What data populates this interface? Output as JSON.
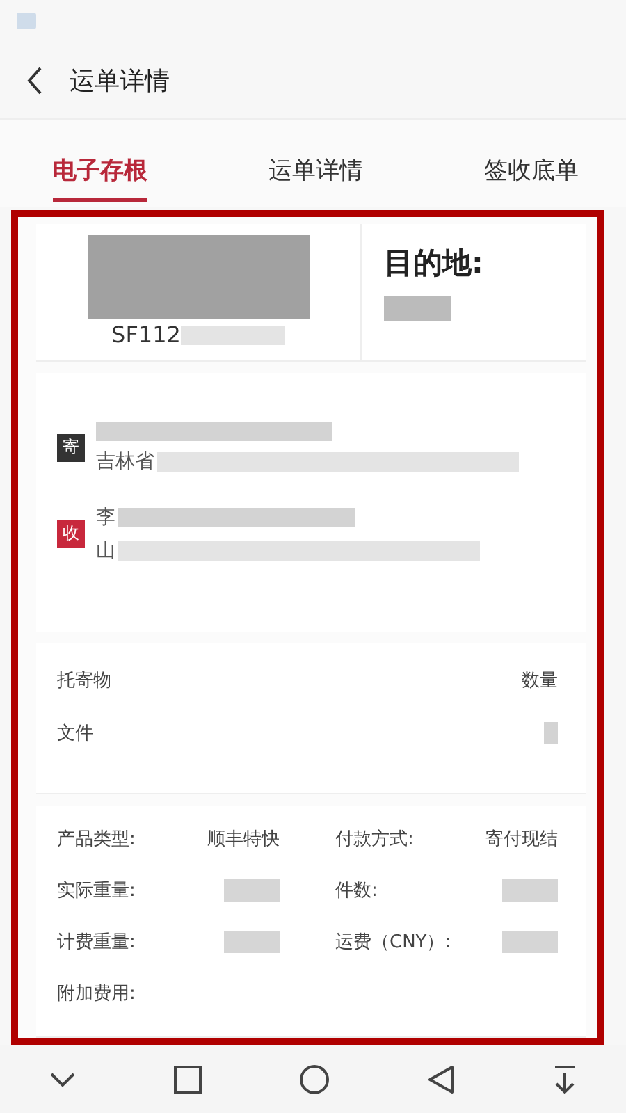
{
  "header": {
    "title": "运单详情"
  },
  "tabs": [
    {
      "label": "电子存根",
      "selected": true
    },
    {
      "label": "运单详情",
      "selected": false
    },
    {
      "label": "签收底单",
      "selected": false
    }
  ],
  "waybill": {
    "number": "SF112",
    "destination_label": "目的地:"
  },
  "parties": [
    {
      "badge": "寄",
      "color": "#333333",
      "address": "吉林省"
    },
    {
      "badge": "收",
      "color": "#c8283c",
      "name": "李",
      "address": "山"
    }
  ],
  "goods": {
    "header_left": "托寄物",
    "header_right": "数量",
    "item": "文件"
  },
  "details": [
    {
      "label": "产品类型:",
      "value": "顺丰特快",
      "redacted": false
    },
    {
      "label": "付款方式:",
      "value": "寄付现结",
      "redacted": false
    },
    {
      "label": "实际重量:",
      "redacted": true
    },
    {
      "label": "件数:",
      "redacted": true
    },
    {
      "label": "计费重量:",
      "redacted": true
    },
    {
      "label": "运费（CNY）:",
      "redacted": true
    },
    {
      "label": "附加费用:",
      "redacted": false
    }
  ]
}
